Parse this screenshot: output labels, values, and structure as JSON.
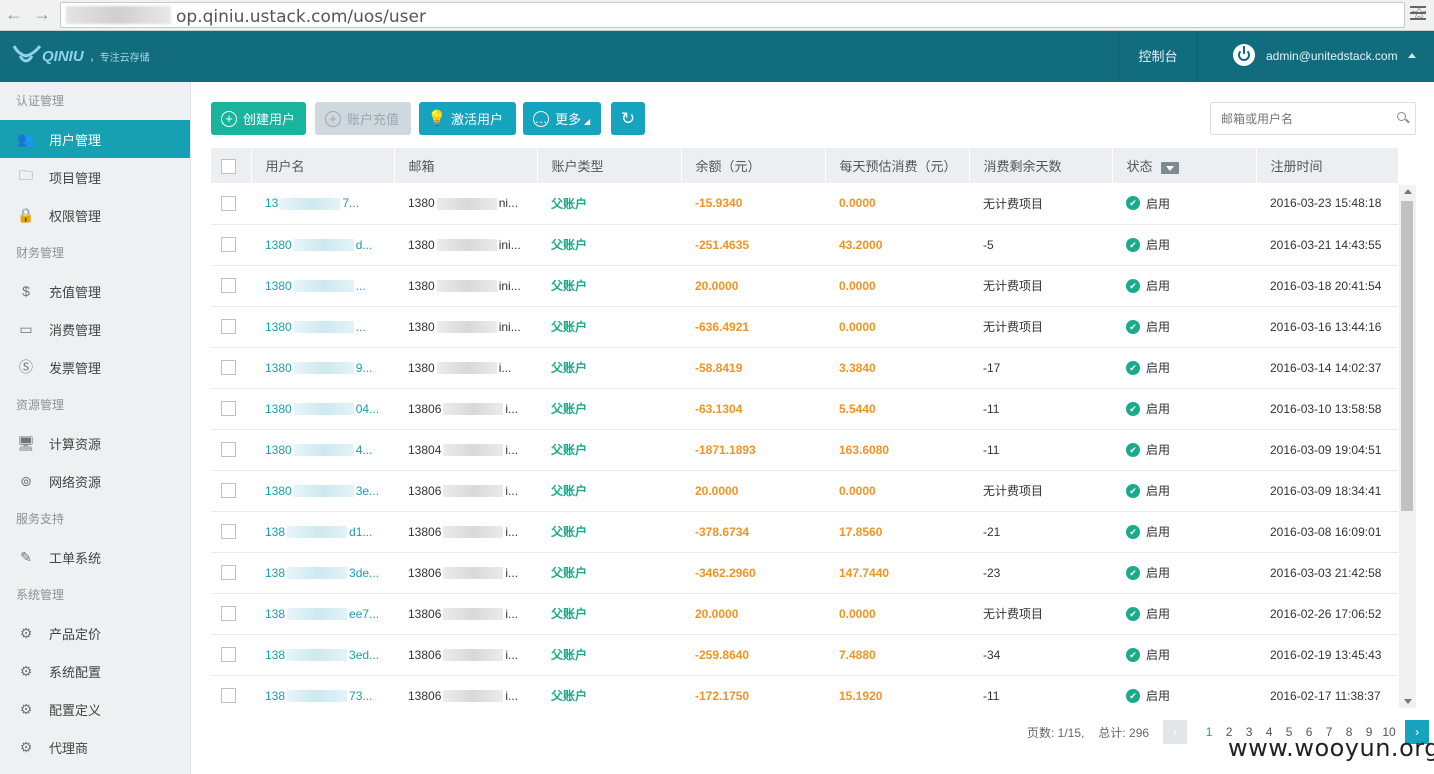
{
  "browser": {
    "url": "op.qiniu.ustack.com/uos/user",
    "back_icon": "←",
    "forward_icon": "→",
    "star_icon": "☆"
  },
  "header": {
    "logo_text": "QINIU",
    "slogan": "，专注云存储",
    "console": "控制台",
    "user": "admin@unitedstack.com"
  },
  "sidebar": {
    "groups": [
      {
        "title": "认证管理",
        "items": [
          {
            "label": "用户管理",
            "icon": "👥",
            "active": true
          },
          {
            "label": "项目管理",
            "icon": "🗀"
          },
          {
            "label": "权限管理",
            "icon": "🔒"
          }
        ]
      },
      {
        "title": "财务管理",
        "items": [
          {
            "label": "充值管理",
            "icon": "$"
          },
          {
            "label": "消费管理",
            "icon": "▭"
          },
          {
            "label": "发票管理",
            "icon": "Ⓢ"
          }
        ]
      },
      {
        "title": "资源管理",
        "items": [
          {
            "label": "计算资源",
            "icon": "🖥"
          },
          {
            "label": "网络资源",
            "icon": "⊚"
          }
        ]
      },
      {
        "title": "服务支持",
        "items": [
          {
            "label": "工单系统",
            "icon": "✎"
          }
        ]
      },
      {
        "title": "系统管理",
        "items": [
          {
            "label": "产品定价",
            "icon": "⚙"
          },
          {
            "label": "系统配置",
            "icon": "⚙"
          },
          {
            "label": "配置定义",
            "icon": "⚙"
          },
          {
            "label": "代理商",
            "icon": "⚙"
          }
        ]
      }
    ]
  },
  "toolbar": {
    "create": "创建用户",
    "recharge": "账户充值",
    "activate": "激活用户",
    "more": "更多",
    "refresh_icon": "↻",
    "search_placeholder": "邮箱或用户名"
  },
  "table": {
    "headers": [
      "用户名",
      "邮箱",
      "账户类型",
      "余额（元）",
      "每天预估消费（元）",
      "消费剩余天数",
      "状态",
      "注册时间"
    ],
    "rows": [
      {
        "user_a": "13",
        "user_b": "7...",
        "email_a": "1380",
        "email_b": "ni...",
        "type": "父账户",
        "balance": "-15.9340",
        "daily": "0.0000",
        "days": "无计费项目",
        "status": "启用",
        "time": "2016-03-23 15:48:18"
      },
      {
        "user_a": "1380",
        "user_b": "d...",
        "email_a": "1380",
        "email_b": "ini...",
        "type": "父账户",
        "balance": "-251.4635",
        "daily": "43.2000",
        "days": "-5",
        "status": "启用",
        "time": "2016-03-21 14:43:55"
      },
      {
        "user_a": "1380",
        "user_b": "...",
        "email_a": "1380",
        "email_b": "ini...",
        "type": "父账户",
        "balance": "20.0000",
        "daily": "0.0000",
        "days": "无计费项目",
        "status": "启用",
        "time": "2016-03-18 20:41:54"
      },
      {
        "user_a": "1380",
        "user_b": "...",
        "email_a": "1380",
        "email_b": "ini...",
        "type": "父账户",
        "balance": "-636.4921",
        "daily": "0.0000",
        "days": "无计费项目",
        "status": "启用",
        "time": "2016-03-16 13:44:16"
      },
      {
        "user_a": "1380",
        "user_b": "9...",
        "email_a": "1380",
        "email_b": "i...",
        "type": "父账户",
        "balance": "-58.8419",
        "daily": "3.3840",
        "days": "-17",
        "status": "启用",
        "time": "2016-03-14 14:02:37"
      },
      {
        "user_a": "1380",
        "user_b": "04...",
        "email_a": "13806",
        "email_b": "i...",
        "type": "父账户",
        "balance": "-63.1304",
        "daily": "5.5440",
        "days": "-11",
        "status": "启用",
        "time": "2016-03-10 13:58:58"
      },
      {
        "user_a": "1380",
        "user_b": "4...",
        "email_a": "13804",
        "email_b": "i...",
        "type": "父账户",
        "balance": "-1871.1893",
        "daily": "163.6080",
        "days": "-11",
        "status": "启用",
        "time": "2016-03-09 19:04:51"
      },
      {
        "user_a": "1380",
        "user_b": "3e...",
        "email_a": "13806",
        "email_b": "i...",
        "type": "父账户",
        "balance": "20.0000",
        "daily": "0.0000",
        "days": "无计费项目",
        "status": "启用",
        "time": "2016-03-09 18:34:41"
      },
      {
        "user_a": "138",
        "user_b": "d1...",
        "email_a": "13806",
        "email_b": "i...",
        "type": "父账户",
        "balance": "-378.6734",
        "daily": "17.8560",
        "days": "-21",
        "status": "启用",
        "time": "2016-03-08 16:09:01"
      },
      {
        "user_a": "138",
        "user_b": "3de...",
        "email_a": "13806",
        "email_b": "i...",
        "type": "父账户",
        "balance": "-3462.2960",
        "daily": "147.7440",
        "days": "-23",
        "status": "启用",
        "time": "2016-03-03 21:42:58"
      },
      {
        "user_a": "138",
        "user_b": "ee7...",
        "email_a": "13806",
        "email_b": "i...",
        "type": "父账户",
        "balance": "20.0000",
        "daily": "0.0000",
        "days": "无计费项目",
        "status": "启用",
        "time": "2016-02-26 17:06:52"
      },
      {
        "user_a": "138",
        "user_b": "3ed...",
        "email_a": "13806",
        "email_b": "i...",
        "type": "父账户",
        "balance": "-259.8640",
        "daily": "7.4880",
        "days": "-34",
        "status": "启用",
        "time": "2016-02-19 13:45:43"
      },
      {
        "user_a": "138",
        "user_b": "73...",
        "email_a": "13806",
        "email_b": "i...",
        "type": "父账户",
        "balance": "-172.1750",
        "daily": "15.1920",
        "days": "-11",
        "status": "启用",
        "time": "2016-02-17 11:38:37"
      }
    ]
  },
  "pagination": {
    "page_info": "页数: 1/15,",
    "total": "总计: 296",
    "prev_icon": "‹",
    "next_icon": "›",
    "pages": [
      "1",
      "2",
      "3",
      "4",
      "5",
      "6",
      "7",
      "8",
      "9",
      "10"
    ],
    "current": "1"
  },
  "watermark": "www.wooyun.org",
  "colors": {
    "header": "#116c7e",
    "accent": "#17a0b1",
    "create_button": "#1ab39d",
    "money": "#f29322",
    "account_type": "#1aab8a"
  }
}
